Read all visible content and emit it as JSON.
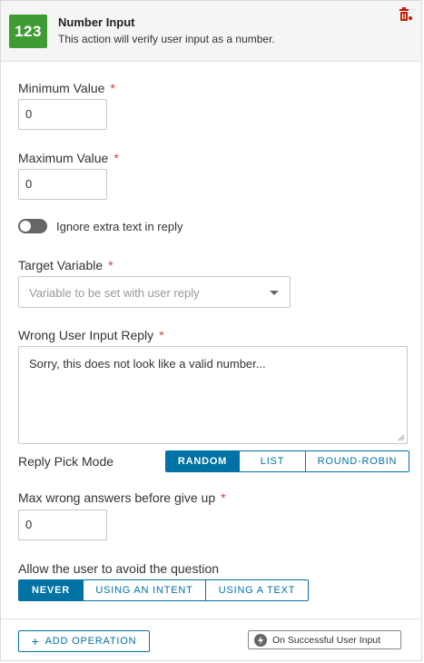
{
  "header": {
    "badge": "123",
    "title": "Number Input",
    "subtitle": "This action will verify user input as a number."
  },
  "min": {
    "label": "Minimum Value",
    "required": "*",
    "value": "0"
  },
  "max": {
    "label": "Maximum Value",
    "required": "*",
    "value": "0"
  },
  "toggle": {
    "label": "Ignore extra text in reply",
    "on": false
  },
  "target": {
    "label": "Target Variable",
    "required": "*",
    "placeholder": "Variable to be set with user reply"
  },
  "wrong": {
    "label": "Wrong User Input Reply",
    "required": "*",
    "value": "Sorry, this does not look like a valid number..."
  },
  "pick_mode": {
    "label": "Reply Pick Mode",
    "options": [
      "RANDOM",
      "LIST",
      "ROUND-ROBIN"
    ],
    "selected": "RANDOM"
  },
  "max_wrong": {
    "label": "Max wrong answers before give up",
    "required": "*",
    "value": "0"
  },
  "avoid": {
    "label": "Allow the user to avoid the question",
    "options": [
      "NEVER",
      "USING AN INTENT",
      "USING A TEXT"
    ],
    "selected": "NEVER"
  },
  "footer": {
    "add_operation": "ADD OPERATION",
    "success_label": "On Successful User Input"
  },
  "colors": {
    "accent": "#0072a3",
    "badge": "#3f9c35",
    "required": "#d0413e",
    "trash": "#c21d00"
  },
  "icons": {
    "trash": "trash-icon",
    "plus": "plus-icon",
    "bolt": "lightning-icon",
    "caret": "chevron-down-icon"
  }
}
